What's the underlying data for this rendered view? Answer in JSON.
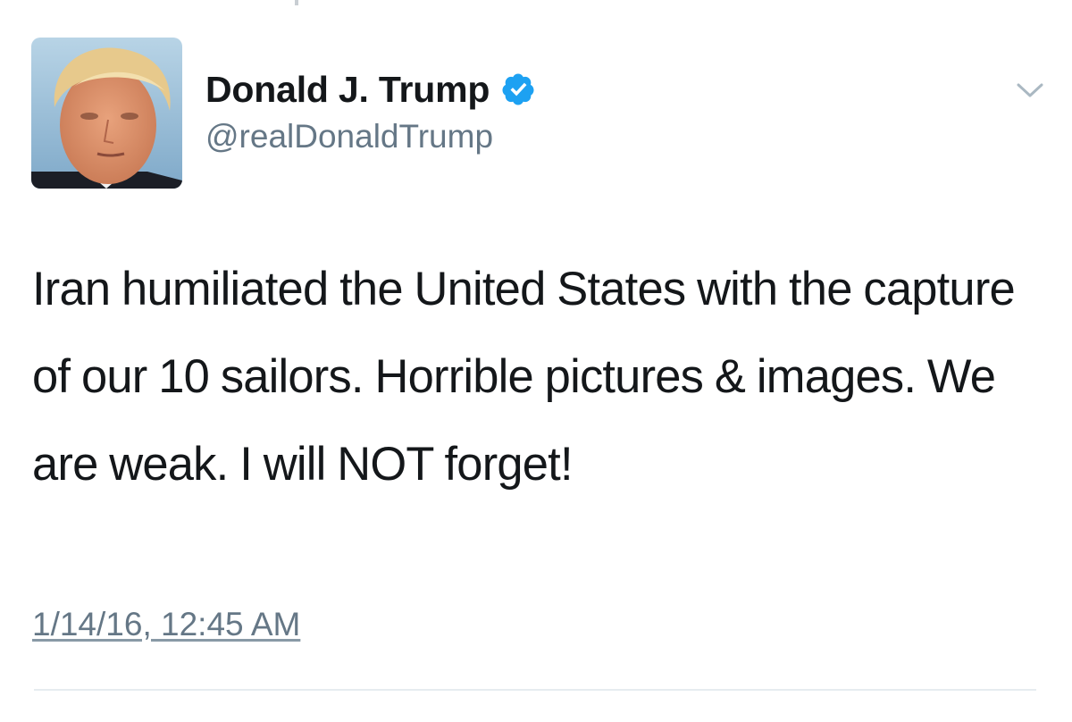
{
  "tweet": {
    "author": {
      "display_name": "Donald J. Trump",
      "handle": "@realDonaldTrump",
      "verified": true,
      "verified_icon": "verified-badge-icon",
      "avatar_icon": "profile-photo"
    },
    "menu_icon": "chevron-down-icon",
    "text": "Iran humiliated the United States with the capture of our 10 sailors. Horrible pictures & images. We are weak. I will NOT forget!",
    "timestamp": "1/14/16, 12:45 AM"
  },
  "colors": {
    "primary_text": "#14171a",
    "secondary_text": "#657786",
    "verified_blue": "#1da1f2",
    "divider": "#e6ecf0",
    "background": "#ffffff"
  }
}
